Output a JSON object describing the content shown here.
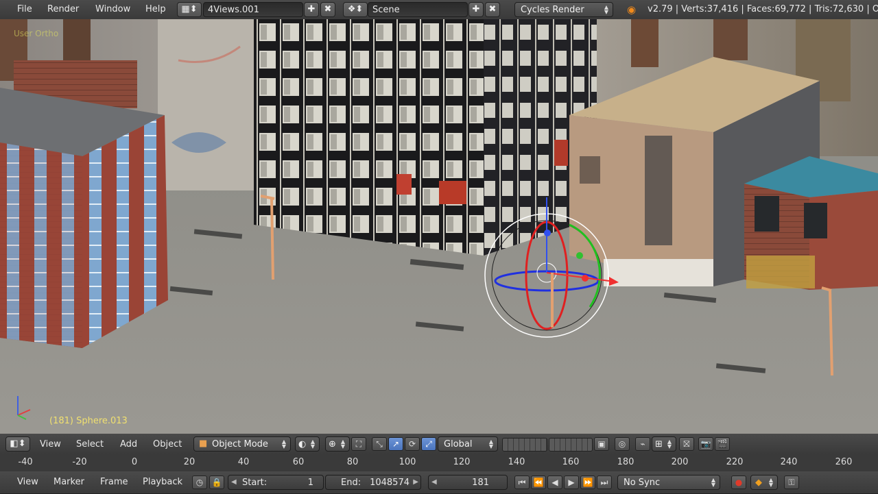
{
  "top_menu": {
    "items": [
      "File",
      "Render",
      "Window",
      "Help"
    ],
    "screen_layout": "4Views.001",
    "scene": "Scene",
    "render_engine": "Cycles Render",
    "stats": "v2.79 | Verts:37,416 | Faces:69,772 | Tris:72,630 | O"
  },
  "viewport": {
    "view_label": "User Ortho",
    "active_object": "(181) Sphere.013"
  },
  "view3d_header": {
    "menus": [
      "View",
      "Select",
      "Add",
      "Object"
    ],
    "mode": "Object Mode",
    "orientation": "Global"
  },
  "timeline_ruler": {
    "ticks": [
      "-40",
      "-20",
      "0",
      "20",
      "40",
      "60",
      "80",
      "100",
      "120",
      "140",
      "160",
      "180",
      "200",
      "220",
      "240",
      "260"
    ]
  },
  "timeline": {
    "menus": [
      "View",
      "Marker",
      "Frame",
      "Playback"
    ],
    "start_label": "Start:",
    "start_value": "1",
    "end_label": "End:",
    "end_value": "1048574",
    "current_frame": "181",
    "sync": "No Sync"
  },
  "colors": {
    "accent_blue": "#4a74bd",
    "record_red": "#e03a2a",
    "keyframe_orange": "#f0a020",
    "overlay_yellow": "#f0e070"
  }
}
